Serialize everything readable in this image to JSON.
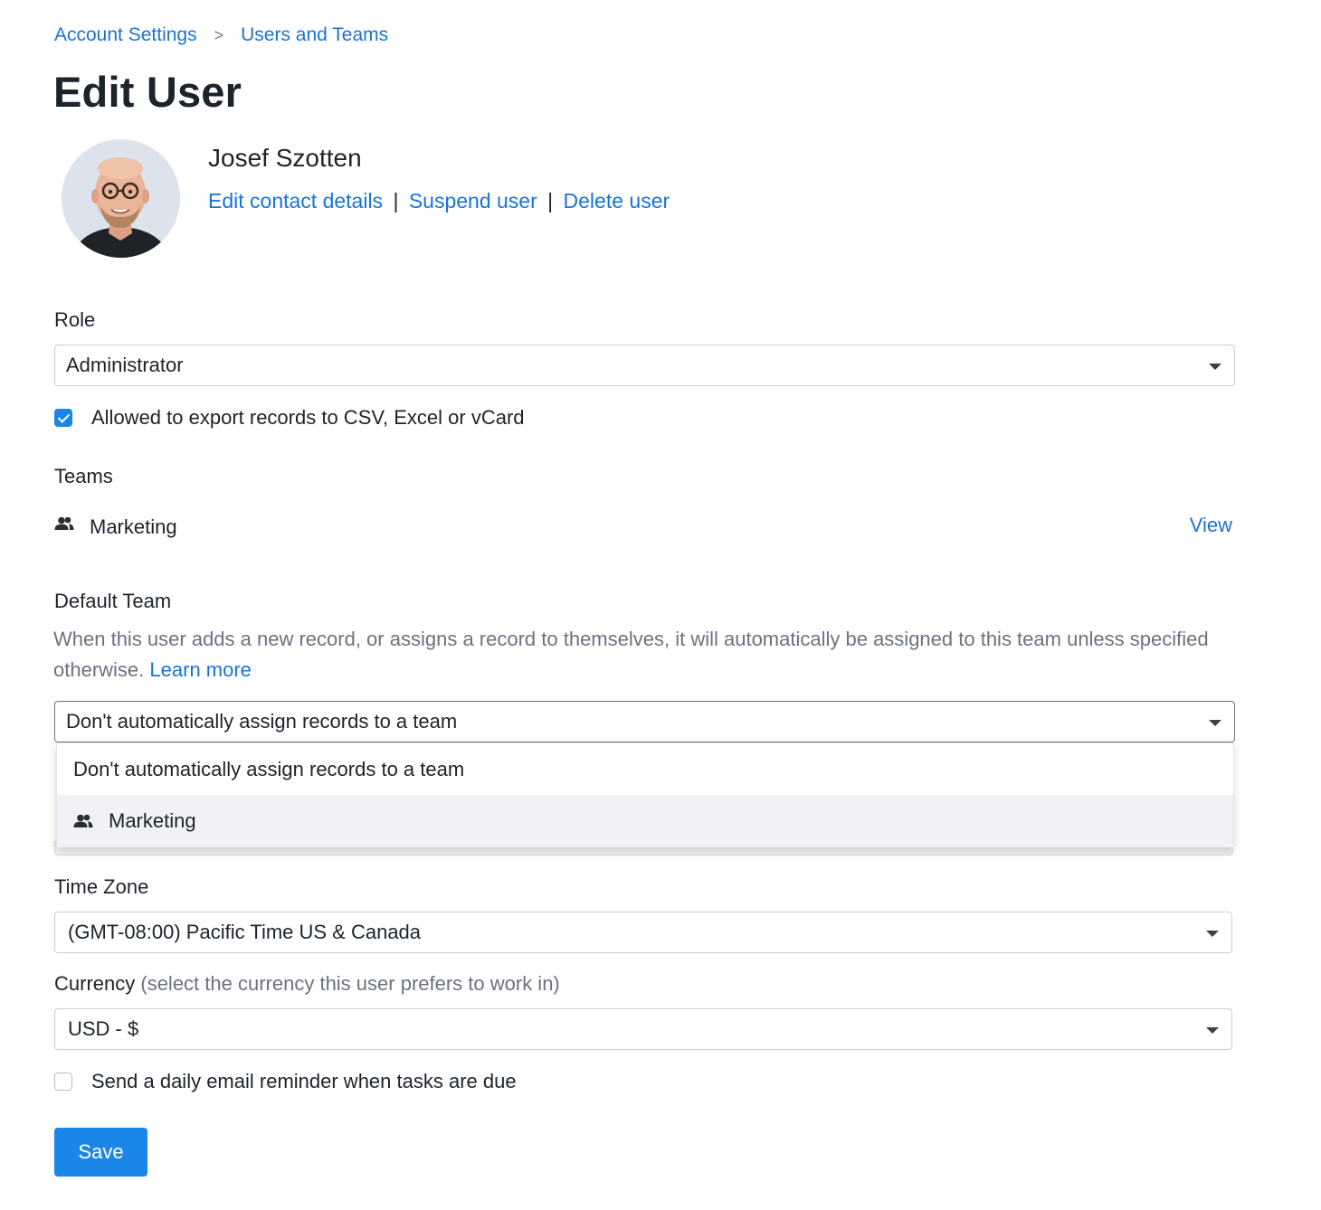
{
  "breadcrumb": {
    "parent": "Account Settings",
    "separator": ">",
    "current": "Users and Teams"
  },
  "page_title": "Edit User",
  "user": {
    "name": "Josef Szotten",
    "actions": {
      "edit": "Edit contact details",
      "suspend": "Suspend user",
      "delete": "Delete user",
      "divider": "|"
    }
  },
  "role": {
    "label": "Role",
    "selected": "Administrator"
  },
  "export_permission": {
    "label": "Allowed to export records to CSV, Excel or vCard",
    "checked": true
  },
  "teams": {
    "label": "Teams",
    "items": [
      {
        "icon": "team-icon",
        "name": "Marketing",
        "action": "View"
      }
    ]
  },
  "default_team": {
    "label": "Default Team",
    "help_text": "When this user adds a new record, or assigns a record to themselves, it will automatically be assigned to this team unless specified otherwise.",
    "learn_more": "Learn more",
    "selected": "Don't automatically assign records to a team",
    "options": [
      {
        "label": "Don't automatically assign records to a team"
      },
      {
        "label": "Marketing",
        "icon": "team-icon"
      }
    ]
  },
  "time_zone": {
    "label": "Time Zone",
    "selected": "(GMT-08:00) Pacific Time US & Canada"
  },
  "currency": {
    "label": "Currency",
    "hint": "(select the currency this user prefers to work in)",
    "selected": "USD - $"
  },
  "email_reminder": {
    "label": "Send a daily email reminder when tasks are due",
    "checked": false
  },
  "save_label": "Save",
  "colors": {
    "link": "#1a73d9",
    "primary_button": "#1a86e8",
    "text": "#1d232b",
    "muted": "#6b7280"
  }
}
